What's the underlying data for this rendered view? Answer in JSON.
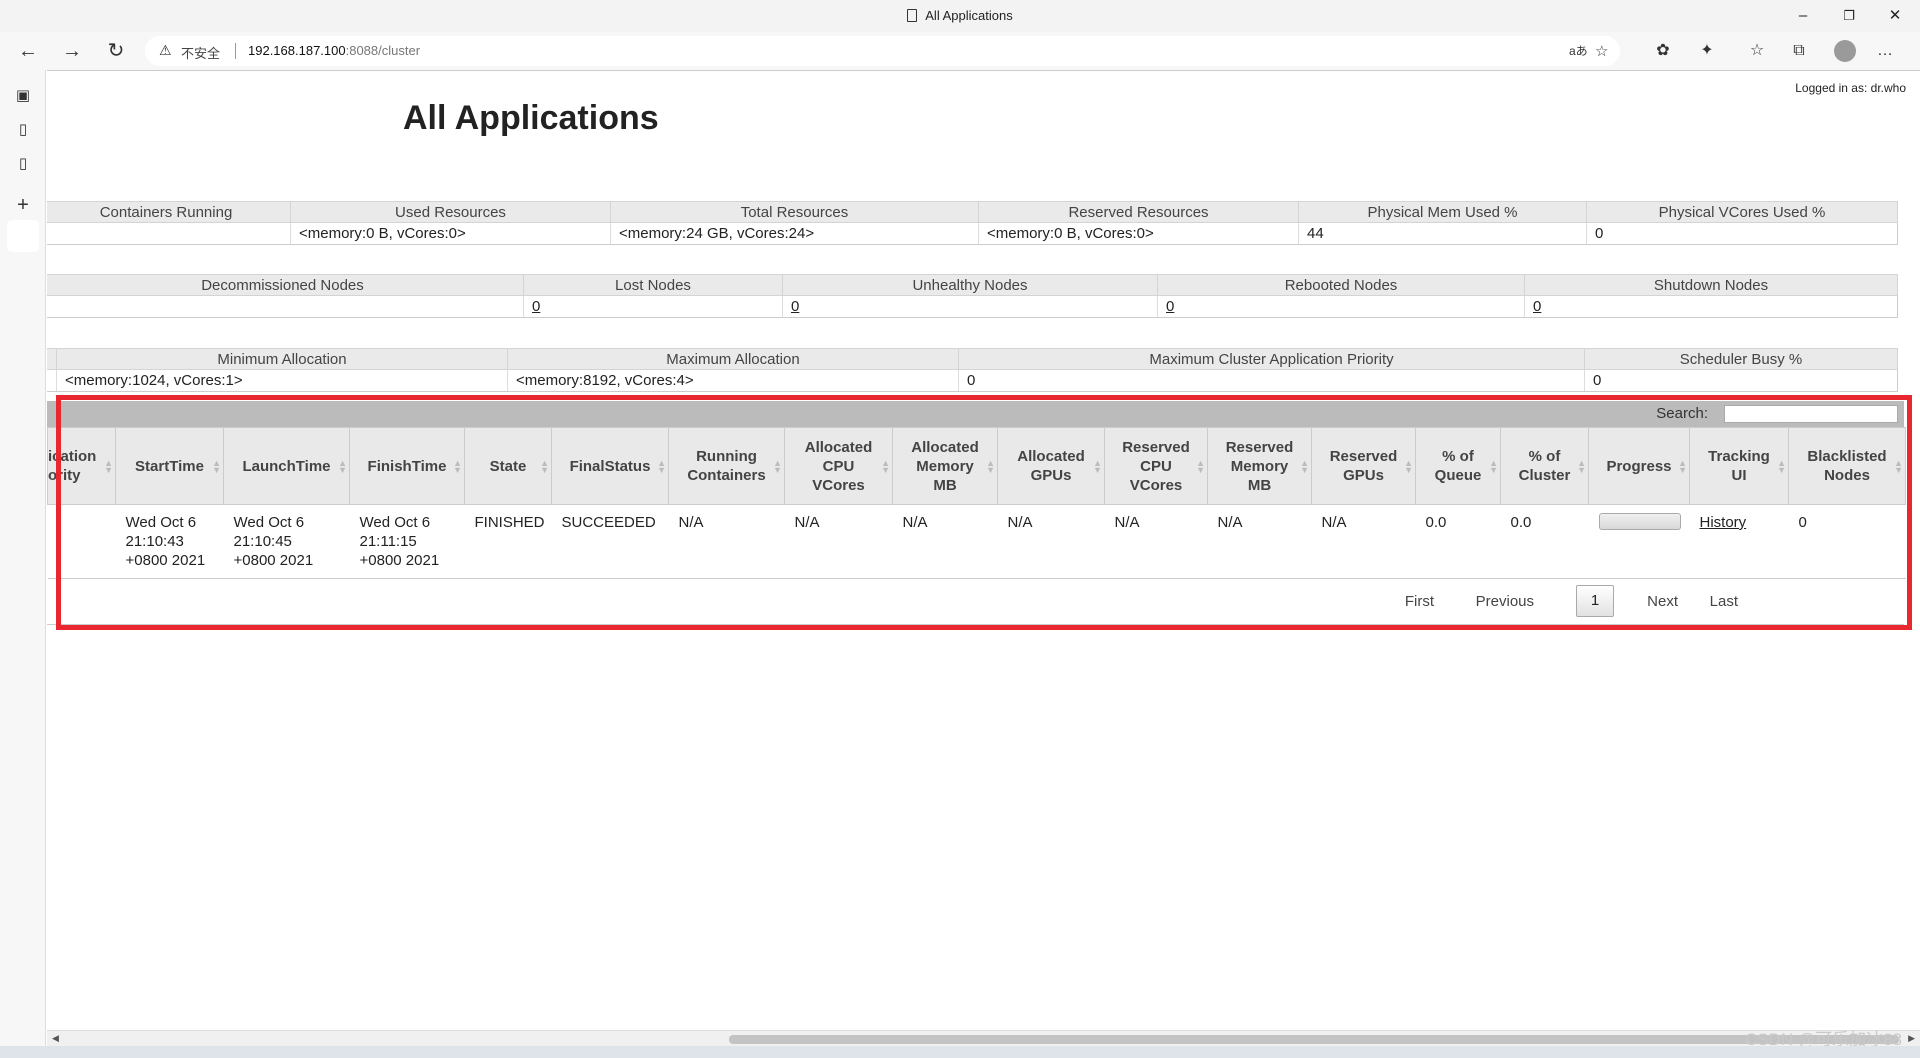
{
  "browser": {
    "tab_title": "All Applications",
    "insecure_label": "不安全",
    "url_host": "192.168.187.100",
    "url_rest": ":8088/cluster",
    "window_controls": {
      "minimize": "–",
      "restore": "❐",
      "close": "✕"
    },
    "nav": {
      "back": "←",
      "forward": "→",
      "refresh": "↻"
    },
    "icons": {
      "read_aloud": "aあ",
      "favorite_add": "☆",
      "extension": "✿",
      "puzzle": "✦",
      "favorites": "☆",
      "collections": "⧉",
      "more": "…"
    }
  },
  "page": {
    "logged_in": "Logged in as: dr.who",
    "title": "All Applications"
  },
  "cluster_metrics": {
    "headers": [
      "Containers Running",
      "Used Resources",
      "Total Resources",
      "Reserved Resources",
      "Physical Mem Used %",
      "Physical VCores Used %"
    ],
    "row": [
      "",
      "<memory:0 B, vCores:0>",
      "<memory:24 GB, vCores:24>",
      "<memory:0 B, vCores:0>",
      "44",
      "0"
    ]
  },
  "node_metrics": {
    "headers": [
      "Decommissioned Nodes",
      "Lost Nodes",
      "Unhealthy Nodes",
      "Rebooted Nodes",
      "Shutdown Nodes"
    ],
    "row": [
      "",
      "0",
      "0",
      "0",
      "0"
    ]
  },
  "scheduler_metrics": {
    "headers": [
      "Minimum Allocation",
      "Maximum Allocation",
      "Maximum Cluster Application Priority",
      "Scheduler Busy %"
    ],
    "row": [
      "<memory:1024, vCores:1>",
      "<memory:8192, vCores:4>",
      "0",
      "0"
    ]
  },
  "apps": {
    "search_label": "Search:",
    "search_value": "",
    "headers": [
      [
        "ication",
        "ority"
      ],
      [
        "StartTime"
      ],
      [
        "LaunchTime"
      ],
      [
        "FinishTime"
      ],
      [
        "State"
      ],
      [
        "FinalStatus"
      ],
      [
        "Running",
        "Containers"
      ],
      [
        "Allocated",
        "CPU",
        "VCores"
      ],
      [
        "Allocated",
        "Memory",
        "MB"
      ],
      [
        "Allocated",
        "GPUs"
      ],
      [
        "Reserved",
        "CPU",
        "VCores"
      ],
      [
        "Reserved",
        "Memory",
        "MB"
      ],
      [
        "Reserved",
        "GPUs"
      ],
      [
        "% of",
        "Queue"
      ],
      [
        "% of",
        "Cluster"
      ],
      [
        "Progress"
      ],
      [
        "Tracking",
        "UI"
      ],
      [
        "Blacklisted",
        "Nodes"
      ]
    ],
    "row": {
      "priority": "",
      "start_time": [
        "Wed Oct 6",
        "21:10:43",
        "+0800 2021"
      ],
      "launch_time": [
        "Wed Oct 6",
        "21:10:45",
        "+0800 2021"
      ],
      "finish_time": [
        "Wed Oct 6",
        "21:11:15",
        "+0800 2021"
      ],
      "state": "FINISHED",
      "final_status": "SUCCEEDED",
      "running_containers": "N/A",
      "alloc_cpu": "N/A",
      "alloc_mem": "N/A",
      "alloc_gpus": "N/A",
      "res_cpu": "N/A",
      "res_mem": "N/A",
      "res_gpus": "N/A",
      "pct_queue": "0.0",
      "pct_cluster": "0.0",
      "progress_fraction": 0,
      "tracking_ui": "History",
      "blacklisted": "0"
    },
    "pager": {
      "first": "First",
      "previous": "Previous",
      "current": "1",
      "next": "Next",
      "last": "Last"
    }
  },
  "watermark": "CSDN @可乐加冰88",
  "colors": {
    "highlight": "#e8282e"
  }
}
